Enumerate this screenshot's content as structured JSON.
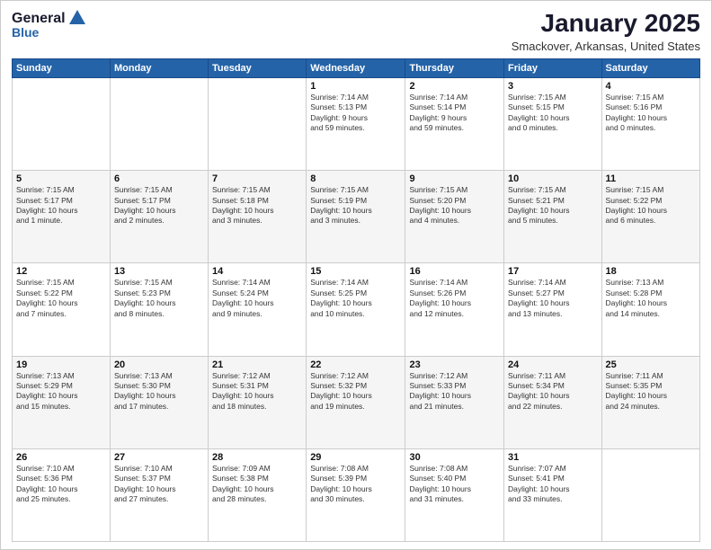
{
  "header": {
    "logo_line1": "General",
    "logo_line2": "Blue",
    "month": "January 2025",
    "location": "Smackover, Arkansas, United States"
  },
  "days_of_week": [
    "Sunday",
    "Monday",
    "Tuesday",
    "Wednesday",
    "Thursday",
    "Friday",
    "Saturday"
  ],
  "weeks": [
    [
      {
        "day": "",
        "info": ""
      },
      {
        "day": "",
        "info": ""
      },
      {
        "day": "",
        "info": ""
      },
      {
        "day": "1",
        "info": "Sunrise: 7:14 AM\nSunset: 5:13 PM\nDaylight: 9 hours\nand 59 minutes."
      },
      {
        "day": "2",
        "info": "Sunrise: 7:14 AM\nSunset: 5:14 PM\nDaylight: 9 hours\nand 59 minutes."
      },
      {
        "day": "3",
        "info": "Sunrise: 7:15 AM\nSunset: 5:15 PM\nDaylight: 10 hours\nand 0 minutes."
      },
      {
        "day": "4",
        "info": "Sunrise: 7:15 AM\nSunset: 5:16 PM\nDaylight: 10 hours\nand 0 minutes."
      }
    ],
    [
      {
        "day": "5",
        "info": "Sunrise: 7:15 AM\nSunset: 5:17 PM\nDaylight: 10 hours\nand 1 minute."
      },
      {
        "day": "6",
        "info": "Sunrise: 7:15 AM\nSunset: 5:17 PM\nDaylight: 10 hours\nand 2 minutes."
      },
      {
        "day": "7",
        "info": "Sunrise: 7:15 AM\nSunset: 5:18 PM\nDaylight: 10 hours\nand 3 minutes."
      },
      {
        "day": "8",
        "info": "Sunrise: 7:15 AM\nSunset: 5:19 PM\nDaylight: 10 hours\nand 3 minutes."
      },
      {
        "day": "9",
        "info": "Sunrise: 7:15 AM\nSunset: 5:20 PM\nDaylight: 10 hours\nand 4 minutes."
      },
      {
        "day": "10",
        "info": "Sunrise: 7:15 AM\nSunset: 5:21 PM\nDaylight: 10 hours\nand 5 minutes."
      },
      {
        "day": "11",
        "info": "Sunrise: 7:15 AM\nSunset: 5:22 PM\nDaylight: 10 hours\nand 6 minutes."
      }
    ],
    [
      {
        "day": "12",
        "info": "Sunrise: 7:15 AM\nSunset: 5:22 PM\nDaylight: 10 hours\nand 7 minutes."
      },
      {
        "day": "13",
        "info": "Sunrise: 7:15 AM\nSunset: 5:23 PM\nDaylight: 10 hours\nand 8 minutes."
      },
      {
        "day": "14",
        "info": "Sunrise: 7:14 AM\nSunset: 5:24 PM\nDaylight: 10 hours\nand 9 minutes."
      },
      {
        "day": "15",
        "info": "Sunrise: 7:14 AM\nSunset: 5:25 PM\nDaylight: 10 hours\nand 10 minutes."
      },
      {
        "day": "16",
        "info": "Sunrise: 7:14 AM\nSunset: 5:26 PM\nDaylight: 10 hours\nand 12 minutes."
      },
      {
        "day": "17",
        "info": "Sunrise: 7:14 AM\nSunset: 5:27 PM\nDaylight: 10 hours\nand 13 minutes."
      },
      {
        "day": "18",
        "info": "Sunrise: 7:13 AM\nSunset: 5:28 PM\nDaylight: 10 hours\nand 14 minutes."
      }
    ],
    [
      {
        "day": "19",
        "info": "Sunrise: 7:13 AM\nSunset: 5:29 PM\nDaylight: 10 hours\nand 15 minutes."
      },
      {
        "day": "20",
        "info": "Sunrise: 7:13 AM\nSunset: 5:30 PM\nDaylight: 10 hours\nand 17 minutes."
      },
      {
        "day": "21",
        "info": "Sunrise: 7:12 AM\nSunset: 5:31 PM\nDaylight: 10 hours\nand 18 minutes."
      },
      {
        "day": "22",
        "info": "Sunrise: 7:12 AM\nSunset: 5:32 PM\nDaylight: 10 hours\nand 19 minutes."
      },
      {
        "day": "23",
        "info": "Sunrise: 7:12 AM\nSunset: 5:33 PM\nDaylight: 10 hours\nand 21 minutes."
      },
      {
        "day": "24",
        "info": "Sunrise: 7:11 AM\nSunset: 5:34 PM\nDaylight: 10 hours\nand 22 minutes."
      },
      {
        "day": "25",
        "info": "Sunrise: 7:11 AM\nSunset: 5:35 PM\nDaylight: 10 hours\nand 24 minutes."
      }
    ],
    [
      {
        "day": "26",
        "info": "Sunrise: 7:10 AM\nSunset: 5:36 PM\nDaylight: 10 hours\nand 25 minutes."
      },
      {
        "day": "27",
        "info": "Sunrise: 7:10 AM\nSunset: 5:37 PM\nDaylight: 10 hours\nand 27 minutes."
      },
      {
        "day": "28",
        "info": "Sunrise: 7:09 AM\nSunset: 5:38 PM\nDaylight: 10 hours\nand 28 minutes."
      },
      {
        "day": "29",
        "info": "Sunrise: 7:08 AM\nSunset: 5:39 PM\nDaylight: 10 hours\nand 30 minutes."
      },
      {
        "day": "30",
        "info": "Sunrise: 7:08 AM\nSunset: 5:40 PM\nDaylight: 10 hours\nand 31 minutes."
      },
      {
        "day": "31",
        "info": "Sunrise: 7:07 AM\nSunset: 5:41 PM\nDaylight: 10 hours\nand 33 minutes."
      },
      {
        "day": "",
        "info": ""
      }
    ]
  ]
}
